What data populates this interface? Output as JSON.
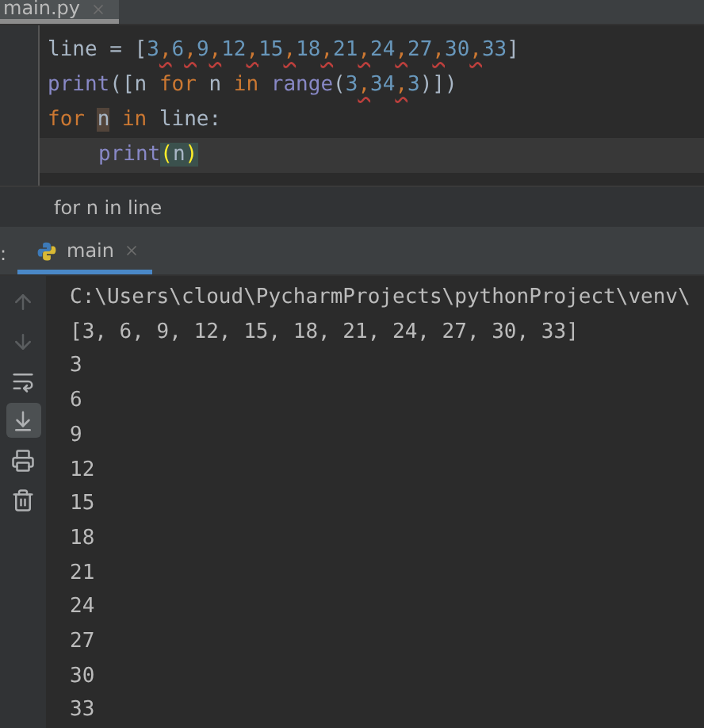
{
  "editor_tab": {
    "label": "main.py",
    "selected": true
  },
  "code": [
    {
      "current": false,
      "indent": false,
      "tokens": [
        {
          "text": "line = [",
          "kind": "plain"
        },
        {
          "text": "3",
          "kind": "number"
        },
        {
          "text": ",",
          "kind": "warn"
        },
        {
          "text": "6",
          "kind": "number"
        },
        {
          "text": ",",
          "kind": "warn"
        },
        {
          "text": "9",
          "kind": "number"
        },
        {
          "text": ",",
          "kind": "warn"
        },
        {
          "text": "12",
          "kind": "number"
        },
        {
          "text": ",",
          "kind": "warn"
        },
        {
          "text": "15",
          "kind": "number"
        },
        {
          "text": ",",
          "kind": "warn"
        },
        {
          "text": "18",
          "kind": "number"
        },
        {
          "text": ",",
          "kind": "warn"
        },
        {
          "text": "21",
          "kind": "number"
        },
        {
          "text": ",",
          "kind": "warn"
        },
        {
          "text": "24",
          "kind": "number"
        },
        {
          "text": ",",
          "kind": "warn"
        },
        {
          "text": "27",
          "kind": "number"
        },
        {
          "text": ",",
          "kind": "warn"
        },
        {
          "text": "30",
          "kind": "number"
        },
        {
          "text": ",",
          "kind": "warn"
        },
        {
          "text": "33",
          "kind": "number"
        },
        {
          "text": "]",
          "kind": "plain"
        }
      ]
    },
    {
      "current": false,
      "indent": false,
      "tokens": [
        {
          "text": "print",
          "kind": "builtin"
        },
        {
          "text": "([n ",
          "kind": "plain"
        },
        {
          "text": "for",
          "kind": "keyword"
        },
        {
          "text": " n ",
          "kind": "plain"
        },
        {
          "text": "in ",
          "kind": "keyword"
        },
        {
          "text": "range",
          "kind": "builtin"
        },
        {
          "text": "(",
          "kind": "plain"
        },
        {
          "text": "3",
          "kind": "number"
        },
        {
          "text": ",",
          "kind": "warn"
        },
        {
          "text": "34",
          "kind": "number"
        },
        {
          "text": ",",
          "kind": "warn"
        },
        {
          "text": "3",
          "kind": "number"
        },
        {
          "text": ")])",
          "kind": "plain"
        }
      ]
    },
    {
      "current": false,
      "indent": false,
      "tokens": [
        {
          "text": "for ",
          "kind": "keyword"
        },
        {
          "text": "n",
          "kind": "usage"
        },
        {
          "text": " in",
          "kind": "keyword"
        },
        {
          "text": " line:",
          "kind": "plain"
        }
      ]
    },
    {
      "current": true,
      "indent": true,
      "tokens": [
        {
          "text": "print",
          "kind": "builtin"
        },
        {
          "text": "(",
          "kind": "brace"
        },
        {
          "text": "n",
          "kind": "bracearg"
        },
        {
          "text": ")",
          "kind": "brace"
        }
      ]
    }
  ],
  "breadcrumb": "for n in line",
  "run_panel": {
    "label_fragment": ":",
    "tab": {
      "label": "main",
      "selected": true
    }
  },
  "console": {
    "toolbar": [
      {
        "kind": "up",
        "disabled": true,
        "on": false
      },
      {
        "kind": "down",
        "disabled": true,
        "on": false
      },
      {
        "kind": "wrap",
        "disabled": false,
        "on": false
      },
      {
        "kind": "scroll",
        "disabled": false,
        "on": true
      },
      {
        "kind": "print",
        "disabled": false,
        "on": false
      },
      {
        "kind": "trash",
        "disabled": false,
        "on": false
      }
    ],
    "lines": [
      "C:\\Users\\cloud\\PycharmProjects\\pythonProject\\venv\\",
      "[3, 6, 9, 12, 15, 18, 21, 24, 27, 30, 33]",
      "3",
      "6",
      "9",
      "12",
      "15",
      "18",
      "21",
      "24",
      "27",
      "30",
      "33"
    ]
  }
}
